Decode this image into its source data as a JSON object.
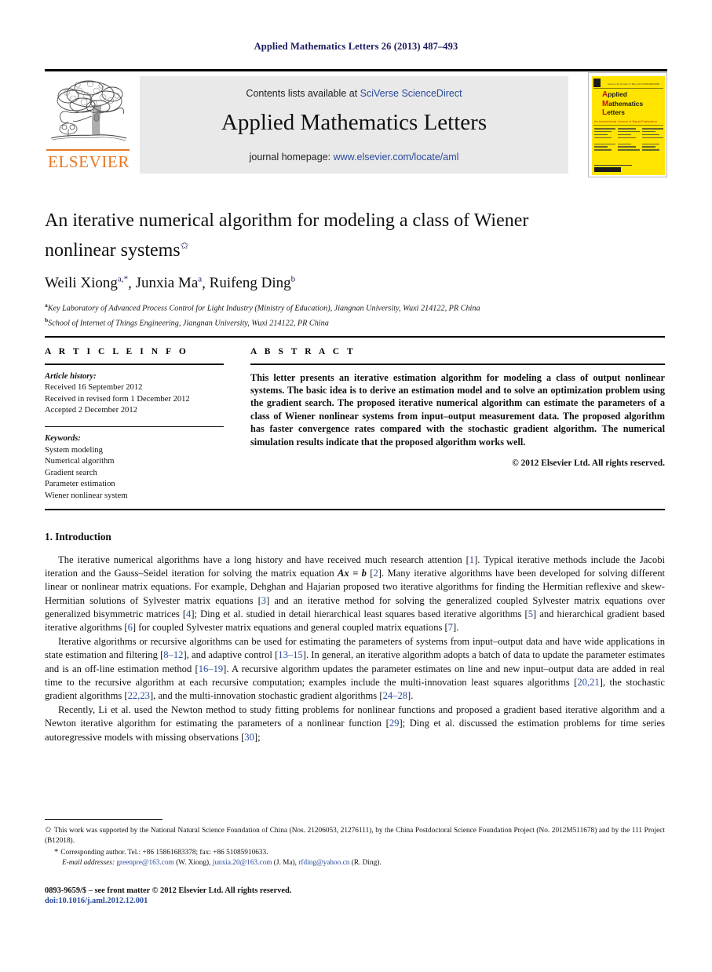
{
  "running_head": "Applied Mathematics Letters 26 (2013) 487–493",
  "masthead": {
    "contents_prefix": "Contents lists available at ",
    "sciencedirect": "SciVerse ScienceDirect",
    "journal_name": "Applied Mathematics Letters",
    "homepage_prefix": "journal homepage: ",
    "homepage_url": "www.elsevier.com/locate/aml",
    "publisher": "ELSEVIER",
    "link_color": "#2a4b9b",
    "banner_bg": "#e9e9e9",
    "publisher_color": "#e87722"
  },
  "cover": {
    "issue_line": "Volume 26 Number 5  May 2013",
    "issn_line": "ISSN 0893-9659",
    "title_line1": "Applied",
    "title_line2": "Mathematics",
    "title_line3": "Letters",
    "subtitle": "An International Journal of Rapid Publication",
    "background": "#ffe400",
    "accent": "#c1121f"
  },
  "article": {
    "title": "An iterative numerical algorithm for modeling a class of Wiener nonlinear systems",
    "title_footnote_mark": "✩",
    "authors": [
      {
        "name": "Weili Xiong",
        "sup": "a,*"
      },
      {
        "name": "Junxia Ma",
        "sup": "a"
      },
      {
        "name": "Ruifeng Ding",
        "sup": "b"
      }
    ],
    "affiliations": [
      {
        "mark": "a",
        "text": "Key Laboratory of Advanced Process Control for Light Industry (Ministry of Education), Jiangnan University, Wuxi 214122, PR China"
      },
      {
        "mark": "b",
        "text": "School of Internet of Things Engineering, Jiangnan University, Wuxi 214122, PR China"
      }
    ]
  },
  "article_info": {
    "heading": "A R T I C L E   I N F O",
    "history_label": "Article history:",
    "history": [
      "Received 16 September 2012",
      "Received in revised form 1 December 2012",
      "Accepted 2 December 2012"
    ],
    "keywords_label": "Keywords:",
    "keywords": [
      "System modeling",
      "Numerical algorithm",
      "Gradient search",
      "Parameter estimation",
      "Wiener nonlinear system"
    ]
  },
  "abstract": {
    "heading": "A B S T R A C T",
    "text": "This letter presents an iterative estimation algorithm for modeling a class of output nonlinear systems. The basic idea is to derive an estimation model and to solve an optimization problem using the gradient search. The proposed iterative numerical algorithm can estimate the parameters of a class of Wiener nonlinear systems from input–output measurement data. The proposed algorithm has faster convergence rates compared with the stochastic gradient algorithm. The numerical simulation results indicate that the proposed algorithm works well.",
    "copyright": "© 2012 Elsevier Ltd. All rights reserved."
  },
  "body": {
    "section_heading": "1. Introduction",
    "paragraph1_parts": [
      "The iterative numerical algorithms have a long history and have received much research attention [",
      "1",
      "]. Typical iterative methods include the Jacobi iteration and the Gauss–Seidel iteration for solving the matrix equation ",
      "Ax = b",
      " [",
      "2",
      "]. Many iterative algorithms have been developed for solving different linear or nonlinear matrix equations. For example, Dehghan and Hajarian proposed two iterative algorithms for finding the Hermitian reflexive and skew-Hermitian solutions of Sylvester matrix equations [",
      "3",
      "] and an iterative method for solving the generalized coupled Sylvester matrix equations over generalized bisymmetric matrices [",
      "4",
      "]; Ding et al. studied in detail hierarchical least squares based iterative algorithms [",
      "5",
      "] and hierarchical gradient based iterative algorithms [",
      "6",
      "] for coupled Sylvester matrix equations and general coupled matrix equations [",
      "7",
      "]."
    ],
    "paragraph2_parts": [
      "Iterative algorithms or recursive algorithms can be used for estimating the parameters of systems from input–output data and have wide applications in state estimation and filtering [",
      "8–12",
      "], and adaptive control [",
      "13–15",
      "]. In general, an iterative algorithm adopts a batch of data to update the parameter estimates and is an off-line estimation method [",
      "16–19",
      "]. A recursive algorithm updates the parameter estimates on line and new input–output data are added in real time to the recursive algorithm at each recursive computation; examples include the multi-innovation least squares algorithms [",
      "20,21",
      "], the stochastic gradient algorithms [",
      "22,23",
      "], and the multi-innovation stochastic gradient algorithms [",
      "24–28",
      "]."
    ],
    "paragraph3_parts": [
      "Recently, Li et al. used the Newton method to study fitting problems for nonlinear functions and proposed a gradient based iterative algorithm and a Newton iterative algorithm for estimating the parameters of a nonlinear function [",
      "29",
      "]; Ding et al. discussed the estimation problems for time series autoregressive models with missing observations [",
      "30",
      "];"
    ]
  },
  "footnotes": {
    "funding_mark": "✩",
    "funding": "This work was supported by the National Natural Science Foundation of China (Nos. 21206053, 21276111), by the China Postdoctoral Science Foundation Project (No. 2012M511678) and by the 111 Project (B12018).",
    "corresponding_mark": "*",
    "corresponding": "Corresponding author. Tel.: +86 15861683378; fax: +86 51085910633.",
    "email_label": "E-mail addresses:",
    "emails": [
      {
        "address": "greenpre@163.com",
        "owner": "(W. Xiong)"
      },
      {
        "address": "junxia.20@163.com",
        "owner": "(J. Ma)"
      },
      {
        "address": "rfding@yahoo.cn",
        "owner": "(R. Ding)"
      }
    ]
  },
  "colophon": {
    "issn_line": "0893-9659/$ – see front matter © 2012 Elsevier Ltd. All rights reserved.",
    "doi": "doi:10.1016/j.aml.2012.12.001"
  }
}
